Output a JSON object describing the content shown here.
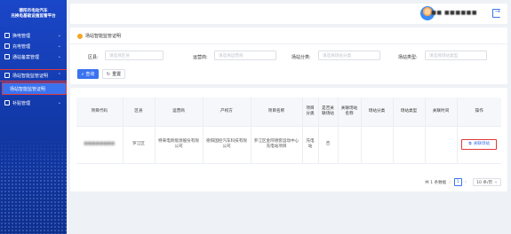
{
  "brand": {
    "line1": "德阳市电动汽车",
    "line2": "充换电基础设施监管平台"
  },
  "sidebar": {
    "items": [
      {
        "label": "换电管理"
      },
      {
        "label": "充电管理"
      },
      {
        "label": "通站备案管理"
      },
      {
        "label": "场站智能监管证明"
      },
      {
        "label": "场站智能监管证明"
      },
      {
        "label": "补贴管理"
      }
    ]
  },
  "topbar": {
    "username": "■■ ■■■■■■"
  },
  "filter": {
    "title": "场站智能监管证明",
    "fields": [
      {
        "label": "区县:",
        "placeholder": "请选择区县"
      },
      {
        "label": "运营商:",
        "placeholder": "请选择运营商"
      },
      {
        "label": "场站分类:",
        "placeholder": "请选择场站分类"
      },
      {
        "label": "场站类型:",
        "placeholder": "请选择场站类型"
      }
    ],
    "search_label": "查询",
    "reset_label": "重置"
  },
  "table": {
    "headers": [
      "项目代码",
      "区县",
      "运营商",
      "产权方",
      "项目名称",
      "项目分类",
      "是否关联场站",
      "关联场站名称",
      "场站分类",
      "场站类型",
      "关联时间",
      "操作"
    ],
    "rows": [
      {
        "code": "■■■■■■■■",
        "district": "罗江区",
        "operator": "特来电新能源股份有限公司",
        "owner": "德阳国控汽车科技有限公司",
        "name": "罗江区金阿德客运动中心充电站项目",
        "category": "充电站",
        "linked": "否",
        "station_name": "",
        "station_class": "",
        "station_type": "",
        "linked_time": "",
        "action_label": "关联场站"
      }
    ]
  },
  "pager": {
    "total": "共 1 条数据",
    "current": "1",
    "size": "10 条/页"
  }
}
